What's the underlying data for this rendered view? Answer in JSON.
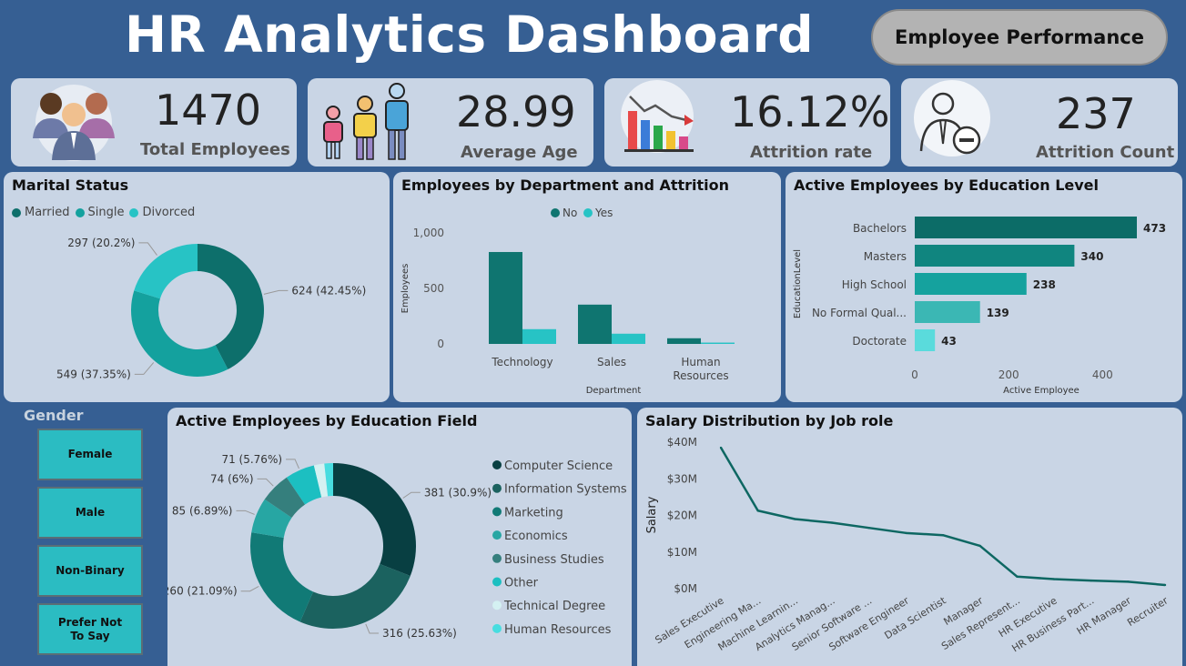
{
  "header": {
    "title": "HR Analytics Dashboard",
    "nav_button": "Employee Performance"
  },
  "kpis": [
    {
      "value": "1470",
      "label": "Total Employees",
      "icon": "people-group-icon"
    },
    {
      "value": "28.99",
      "label": "Average Age",
      "icon": "family-icon"
    },
    {
      "value": "16.12%",
      "label": "Attrition rate",
      "icon": "declining-chart-icon"
    },
    {
      "value": "237",
      "label": "Attrition Count",
      "icon": "employee-minus-icon"
    }
  ],
  "gender_slicer": {
    "title": "Gender",
    "options": [
      "Female",
      "Male",
      "Non-Binary",
      "Prefer Not To Say"
    ]
  },
  "colors": {
    "bg": "#365f93",
    "card": "#c9d5e5",
    "dark_teal": "#0f7570",
    "teal": "#15a19f",
    "light_teal": "#26c5c8"
  },
  "chart_data": [
    {
      "id": "marital",
      "type": "pie",
      "title": "Marital Status",
      "donut": true,
      "legend_position": "top-left",
      "slices": [
        {
          "name": "Married",
          "value": 624,
          "label": "624 (42.45%)",
          "color": "#0d6f6b"
        },
        {
          "name": "Single",
          "value": 549,
          "label": "549 (37.35%)",
          "color": "#14a19e"
        },
        {
          "name": "Divorced",
          "value": 297,
          "label": "297 (20.2%)",
          "color": "#27c3c5"
        }
      ]
    },
    {
      "id": "department",
      "type": "bar",
      "title": "Employees by Department and Attrition",
      "categories": [
        "Technology",
        "Sales",
        "Human\nResources"
      ],
      "series": [
        {
          "name": "No",
          "values": [
            828,
            354,
            51
          ],
          "color": "#0f7570"
        },
        {
          "name": "Yes",
          "values": [
            133,
            92,
            12
          ],
          "color": "#27c3c5"
        }
      ],
      "xlabel": "Department",
      "ylabel": "Employees",
      "ylim": [
        0,
        1000
      ],
      "yticks": [
        "0",
        "500",
        "1,000"
      ],
      "legend_position": "top-center"
    },
    {
      "id": "education_level",
      "type": "bar",
      "orientation": "horizontal",
      "title": "Active Employees by Education Level",
      "categories": [
        "Bachelors",
        "Masters",
        "High School",
        "No Formal Qual...",
        "Doctorate"
      ],
      "values": [
        473,
        340,
        238,
        139,
        43
      ],
      "colors": [
        "#0c6c67",
        "#10857f",
        "#15a29e",
        "#3bb7b4",
        "#5adbdc"
      ],
      "xlabel": "Active Employee",
      "ylabel": "EducationLevel",
      "xlim": [
        0,
        473
      ],
      "xticks": [
        "0",
        "200",
        "400"
      ]
    },
    {
      "id": "education_field",
      "type": "pie",
      "title": "Active Employees by Education Field",
      "donut": true,
      "legend_position": "right",
      "slices": [
        {
          "name": "Computer Science",
          "value": 381,
          "label": "381 (30.9%)",
          "color": "#083f42"
        },
        {
          "name": "Information Systems",
          "value": 316,
          "label": "316 (25.63%)",
          "color": "#1b625f"
        },
        {
          "name": "Marketing",
          "value": 260,
          "label": "260 (21.09%)",
          "color": "#117a76"
        },
        {
          "name": "Economics",
          "value": 85,
          "label": "85 (6.89%)",
          "color": "#27a6a3"
        },
        {
          "name": "Business Studies",
          "value": 74,
          "label": "74 (6%)",
          "color": "#357f7d"
        },
        {
          "name": "Other",
          "value": 71,
          "label": "71 (5.76%)",
          "color": "#1cbfc1"
        },
        {
          "name": "Technical Degree",
          "value": 25,
          "label": "",
          "color": "#d4f1f2"
        },
        {
          "name": "Human Resources",
          "value": 21,
          "label": "",
          "color": "#48dde0"
        }
      ]
    },
    {
      "id": "salary",
      "type": "line",
      "title": "Salary Distribution by Job role",
      "categories": [
        "Sales Executive",
        "Engineering Ma...",
        "Machine Learnin...",
        "Analytics Manag...",
        "Senior Software ...",
        "Software Engineer",
        "Data Scientist",
        "Manager",
        "Sales Represent...",
        "HR Executive",
        "HR Business Part...",
        "HR Manager",
        "Recruiter"
      ],
      "values": [
        38.5,
        21.3,
        19.0,
        18.0,
        16.6,
        15.2,
        14.6,
        11.7,
        3.3,
        2.6,
        2.2,
        1.9,
        1.0
      ],
      "ylabel": "Salary",
      "ylim": [
        0,
        40
      ],
      "yticks": [
        "$0M",
        "$10M",
        "$20M",
        "$30M",
        "$40M"
      ],
      "color": "#0d6762"
    }
  ]
}
